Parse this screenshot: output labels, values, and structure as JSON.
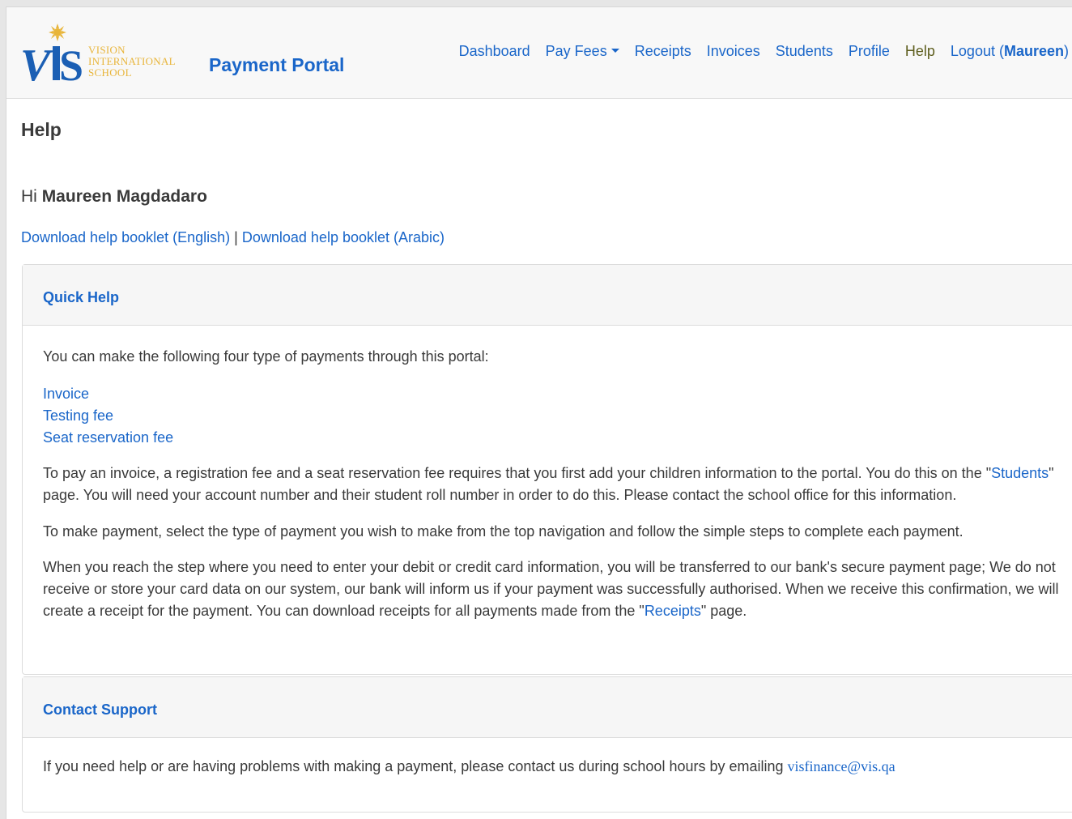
{
  "logo": {
    "line1": "VISION",
    "line2": "INTERNATIONAL",
    "line3": "SCHOOL"
  },
  "brand": "Payment Portal",
  "nav": {
    "dashboard": "Dashboard",
    "pay_fees": "Pay Fees",
    "receipts": "Receipts",
    "invoices": "Invoices",
    "students": "Students",
    "profile": "Profile",
    "help": "Help",
    "logout": "Logout (",
    "logout_user": "Maureen",
    "logout_close": ")"
  },
  "page_title": "Help",
  "greeting": {
    "hi": "Hi",
    "name": "Maureen Magdadaro"
  },
  "downloads": {
    "english": "Download help booklet (English)",
    "separator": "|",
    "arabic": "Download help booklet (Arabic)"
  },
  "quick_help": {
    "header": "Quick Help",
    "intro": "You can make the following four type of payments through this portal:",
    "payment_types": [
      "Invoice",
      "Testing fee",
      "Seat reservation fee"
    ],
    "para1_a": "To pay an invoice, a registration fee and a seat reservation fee requires that you first add your children information to the portal. You do this on the \"",
    "para1_link": "Students",
    "para1_b": "\" page. You will need your account number and their student roll number in order to do this. Please contact the school office for this information.",
    "para2": "To make payment, select the type of payment you wish to make from the top navigation and follow the simple steps to complete each payment.",
    "para3_a": "When you reach the step where you need to enter your debit or credit card information, you will be transferred to our bank's secure payment page; We do not receive or store your card data on our system, our bank will inform us if your payment was successfully authorised. When we receive this confirmation, we will create a receipt for the payment. You can download receipts for all payments made from the \"",
    "para3_link": "Receipts",
    "para3_b": "\" page."
  },
  "contact": {
    "header": "Contact Support",
    "text": "If you need help or are having problems with making a payment, please contact us during school hours by emailing",
    "email": "visfinance@vis.qa"
  },
  "colors": {
    "link": "#1a66c9",
    "active_nav": "#5e5e1e",
    "logo_blue": "#1b5fb4",
    "logo_gold": "#e8b53a"
  }
}
